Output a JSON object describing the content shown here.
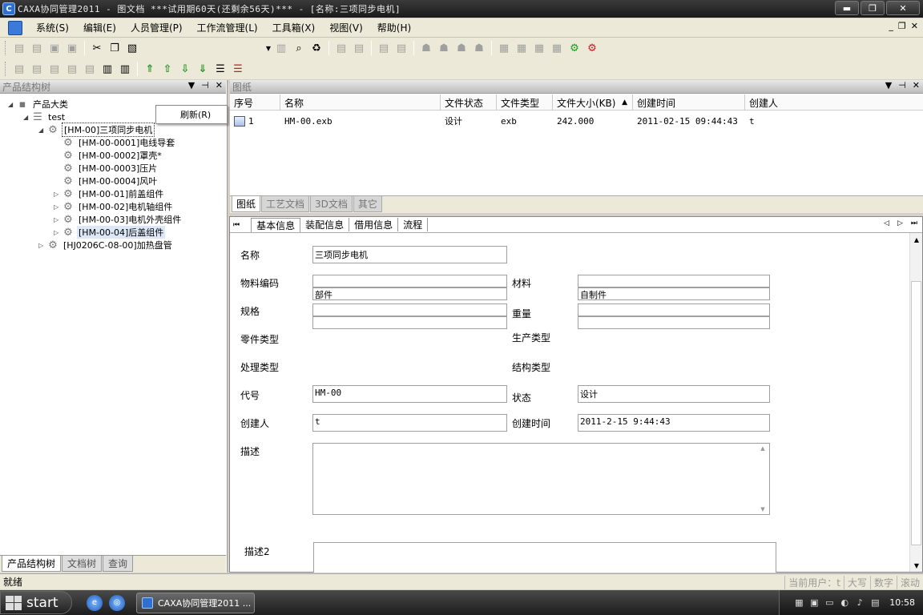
{
  "window": {
    "title": "CAXA协同管理2011 - 图文档    ***试用期60天(还剩余56天)*** - [名称:三项同步电机]",
    "controls": {
      "minimize": "▬",
      "restore": "❐",
      "close": "✕"
    }
  },
  "menu": {
    "items": [
      "系统(S)",
      "编辑(E)",
      "人员管理(P)",
      "工作流管理(L)",
      "工具箱(X)",
      "视图(V)",
      "帮助(H)"
    ],
    "mdi": {
      "minimize": "_",
      "restore": "❐",
      "close": "✕"
    }
  },
  "left_panel": {
    "title": "产品结构树",
    "context_menu_item": "刷新(R)",
    "tree": [
      {
        "label": "产品大类",
        "level": 0,
        "expander": "◢",
        "icon": "folder-icon"
      },
      {
        "label": "test",
        "level": 1,
        "expander": "◢",
        "icon": "database-icon"
      },
      {
        "label": "[HM-00]三项同步电机",
        "level": 2,
        "expander": "◢",
        "icon": "assembly-icon",
        "selected": true
      },
      {
        "label": "[HM-00-0001]电线导套",
        "level": 3,
        "expander": "",
        "icon": "gear-icon"
      },
      {
        "label": "[HM-00-0002]罩壳*",
        "level": 3,
        "expander": "",
        "icon": "gear-icon"
      },
      {
        "label": "[HM-00-0003]压片",
        "level": 3,
        "expander": "",
        "icon": "gear-icon"
      },
      {
        "label": "[HM-00-0004]风叶",
        "level": 3,
        "expander": "",
        "icon": "gear-icon"
      },
      {
        "label": "[HM-00-01]前盖组件",
        "level": 3,
        "expander": "▷",
        "icon": "gear-icon"
      },
      {
        "label": "[HM-00-02]电机轴组件",
        "level": 3,
        "expander": "▷",
        "icon": "gear-icon"
      },
      {
        "label": "[HM-00-03]电机外壳组件",
        "level": 3,
        "expander": "▷",
        "icon": "gear-icon"
      },
      {
        "label": "[HM-00-04]后盖组件",
        "level": 3,
        "expander": "▷",
        "icon": "gear-icon",
        "highlight": true
      },
      {
        "label": "[HJ0206C-08-00]加热盘管",
        "level": 2,
        "expander": "▷",
        "icon": "assembly-icon"
      }
    ],
    "tabs": [
      "产品结构树",
      "文档树",
      "查询"
    ]
  },
  "drawing_panel": {
    "title": "图纸",
    "columns": [
      "序号",
      "名称",
      "文件状态",
      "文件类型",
      "文件大小(KB)",
      "创建时间",
      "创建人"
    ],
    "sort_indicator": "▲",
    "rows": [
      [
        "1",
        "HM-00.exb",
        "设计",
        "exb",
        "242.000",
        "2011-02-15 09:44:43",
        "t"
      ]
    ]
  },
  "doc_tabs": [
    "图纸",
    "工艺文档",
    "3D文档",
    "其它"
  ],
  "info_panel": {
    "tabs": [
      "基本信息",
      "装配信息",
      "借用信息",
      "流程"
    ],
    "labels": {
      "name": "名称",
      "material_code": "物料编码",
      "material": "材料",
      "spec": "规格",
      "weight": "重量",
      "part_type": "零件类型",
      "production_type": "生产类型",
      "process_type": "处理类型",
      "structure_type": "结构类型",
      "code": "代号",
      "status": "状态",
      "creator": "创建人",
      "create_time": "创建时间",
      "description": "描述",
      "description2": "描述2"
    },
    "values": {
      "name": "三项同步电机",
      "material_code_1": "",
      "material_code_2": "部件",
      "material_1": "",
      "material_2": "自制件",
      "spec_1": "",
      "spec_2": "",
      "weight_1": "",
      "weight_2": "",
      "code": "HM-00",
      "status": "设计",
      "creator": "t",
      "create_time": "2011-2-15 9:44:43",
      "description": "",
      "description2": ""
    }
  },
  "status_bar": {
    "text": "就绪",
    "right": [
      "当前用户：t",
      "大写",
      "数字",
      "滚动"
    ]
  },
  "taskbar": {
    "start": "start",
    "task_item": "CAXA协同管理2011 ...",
    "clock": "10:58"
  }
}
